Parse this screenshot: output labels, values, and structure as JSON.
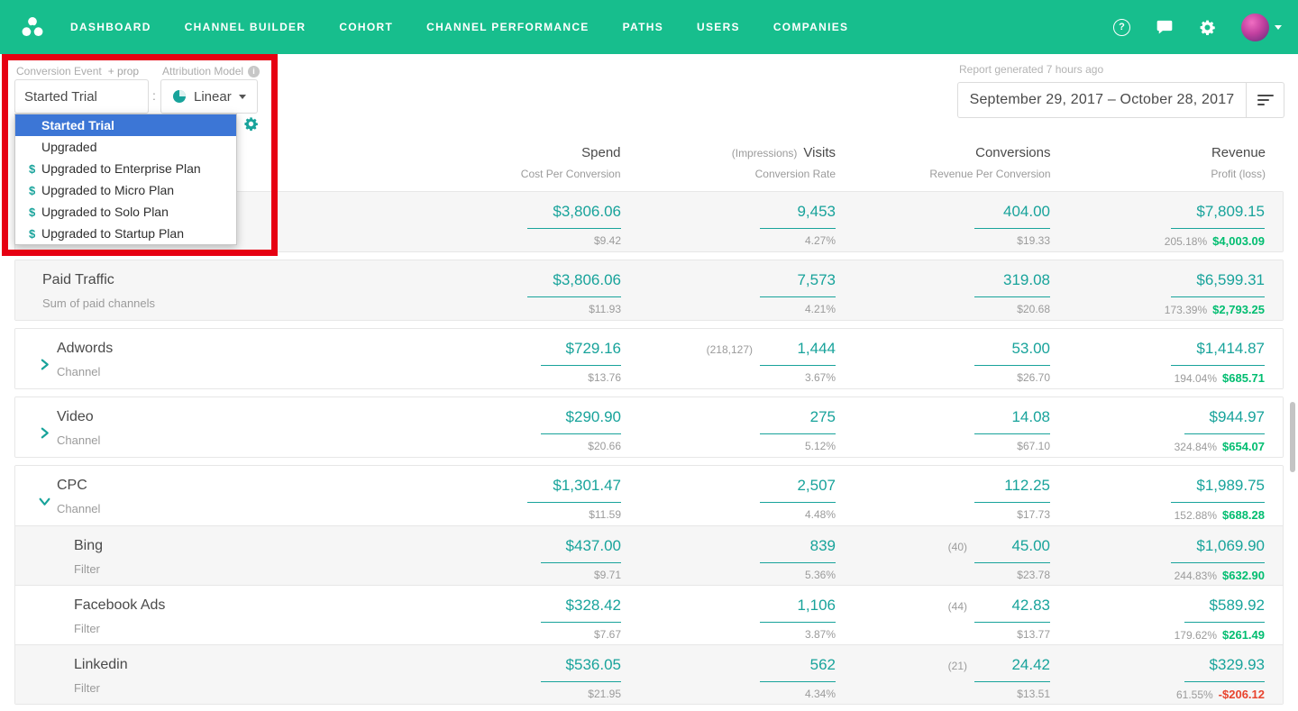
{
  "colors": {
    "nav_green": "#17BE8D",
    "value_teal": "#18A39B",
    "profit_green": "#00BD70",
    "loss_red": "#E8442E",
    "selected_blue": "#3C76D6",
    "annotation_red": "#E60012"
  },
  "icons": {
    "help": "?",
    "info": "i",
    "dollar": "$"
  },
  "nav": {
    "items": [
      "DASHBOARD",
      "CHANNEL BUILDER",
      "COHORT",
      "CHANNEL PERFORMANCE",
      "PATHS",
      "USERS",
      "COMPANIES"
    ],
    "right_icons": [
      "help-icon",
      "chat-icon",
      "gear-icon",
      "avatar"
    ]
  },
  "toolbar": {
    "conversion_event_label": "Conversion Event",
    "add_prop": "+ prop",
    "attribution_model_label": "Attribution Model",
    "conversion_event_value": "Started Trial",
    "colon": ":",
    "attribution_model_value": "Linear",
    "report_generated": "Report generated 7 hours ago",
    "date_range": "September 29, 2017 – October 28, 2017"
  },
  "dropdown": {
    "items": [
      {
        "label": "Started Trial",
        "dollar": false,
        "selected": true
      },
      {
        "label": "Upgraded",
        "dollar": false,
        "selected": false
      },
      {
        "label": "Upgraded to Enterprise Plan",
        "dollar": true,
        "selected": false
      },
      {
        "label": "Upgraded to Micro Plan",
        "dollar": true,
        "selected": false
      },
      {
        "label": "Upgraded to Solo Plan",
        "dollar": true,
        "selected": false
      },
      {
        "label": "Upgraded to Startup Plan",
        "dollar": true,
        "selected": false
      }
    ]
  },
  "table": {
    "columns": [
      {
        "prefix": "",
        "title": "Spend",
        "sub": "Cost Per Conversion"
      },
      {
        "prefix": "(Impressions)",
        "title": "Visits",
        "sub": "Conversion Rate"
      },
      {
        "prefix": "",
        "title": "Conversions",
        "sub": "Revenue Per Conversion"
      },
      {
        "prefix": "",
        "title": "Revenue",
        "sub": "Profit (loss)"
      }
    ],
    "groups": [
      {
        "rows": [
          {
            "name": "",
            "subtitle": "",
            "bg": "gray",
            "chevron": null,
            "child": false,
            "spend": "$3,806.06",
            "spend_sub": "$9.42",
            "visits_prefix": "",
            "visits": "9,453",
            "visits_sub": "4.27%",
            "conversions_prefix": "",
            "conversions": "404.00",
            "conversions_sub": "$19.33",
            "revenue": "$7,809.15",
            "profit_pct": "205.18%",
            "profit": "$4,003.09",
            "profit_negative": false
          }
        ]
      },
      {
        "rows": [
          {
            "name": "Paid Traffic",
            "subtitle": "Sum of paid channels",
            "bg": "gray",
            "chevron": null,
            "child": false,
            "spend": "$3,806.06",
            "spend_sub": "$11.93",
            "visits_prefix": "",
            "visits": "7,573",
            "visits_sub": "4.21%",
            "conversions_prefix": "",
            "conversions": "319.08",
            "conversions_sub": "$20.68",
            "revenue": "$6,599.31",
            "profit_pct": "173.39%",
            "profit": "$2,793.25",
            "profit_negative": false
          }
        ]
      },
      {
        "rows": [
          {
            "name": "Adwords",
            "subtitle": "Channel",
            "bg": "white",
            "chevron": "right",
            "child": false,
            "spend": "$729.16",
            "spend_sub": "$13.76",
            "visits_prefix": "(218,127)",
            "visits": "1,444",
            "visits_sub": "3.67%",
            "conversions_prefix": "",
            "conversions": "53.00",
            "conversions_sub": "$26.70",
            "revenue": "$1,414.87",
            "profit_pct": "194.04%",
            "profit": "$685.71",
            "profit_negative": false
          }
        ]
      },
      {
        "rows": [
          {
            "name": "Video",
            "subtitle": "Channel",
            "bg": "white",
            "chevron": "right",
            "child": false,
            "spend": "$290.90",
            "spend_sub": "$20.66",
            "visits_prefix": "",
            "visits": "275",
            "visits_sub": "5.12%",
            "conversions_prefix": "",
            "conversions": "14.08",
            "conversions_sub": "$67.10",
            "revenue": "$944.97",
            "profit_pct": "324.84%",
            "profit": "$654.07",
            "profit_negative": false
          }
        ]
      },
      {
        "rows": [
          {
            "name": "CPC",
            "subtitle": "Channel",
            "bg": "white",
            "chevron": "down",
            "child": false,
            "spend": "$1,301.47",
            "spend_sub": "$11.59",
            "visits_prefix": "",
            "visits": "2,507",
            "visits_sub": "4.48%",
            "conversions_prefix": "",
            "conversions": "112.25",
            "conversions_sub": "$17.73",
            "revenue": "$1,989.75",
            "profit_pct": "152.88%",
            "profit": "$688.28",
            "profit_negative": false
          },
          {
            "name": "Bing",
            "subtitle": "Filter",
            "bg": "gray",
            "chevron": null,
            "child": true,
            "spend": "$437.00",
            "spend_sub": "$9.71",
            "visits_prefix": "",
            "visits": "839",
            "visits_sub": "5.36%",
            "conversions_prefix": "(40)",
            "conversions": "45.00",
            "conversions_sub": "$23.78",
            "revenue": "$1,069.90",
            "profit_pct": "244.83%",
            "profit": "$632.90",
            "profit_negative": false
          },
          {
            "name": "Facebook Ads",
            "subtitle": "Filter",
            "bg": "white",
            "chevron": null,
            "child": true,
            "spend": "$328.42",
            "spend_sub": "$7.67",
            "visits_prefix": "",
            "visits": "1,106",
            "visits_sub": "3.87%",
            "conversions_prefix": "(44)",
            "conversions": "42.83",
            "conversions_sub": "$13.77",
            "revenue": "$589.92",
            "profit_pct": "179.62%",
            "profit": "$261.49",
            "profit_negative": false
          },
          {
            "name": "Linkedin",
            "subtitle": "Filter",
            "bg": "gray",
            "chevron": null,
            "child": true,
            "spend": "$536.05",
            "spend_sub": "$21.95",
            "visits_prefix": "",
            "visits": "562",
            "visits_sub": "4.34%",
            "conversions_prefix": "(21)",
            "conversions": "24.42",
            "conversions_sub": "$13.51",
            "revenue": "$329.93",
            "profit_pct": "61.55%",
            "profit": "-$206.12",
            "profit_negative": true
          }
        ]
      }
    ]
  }
}
